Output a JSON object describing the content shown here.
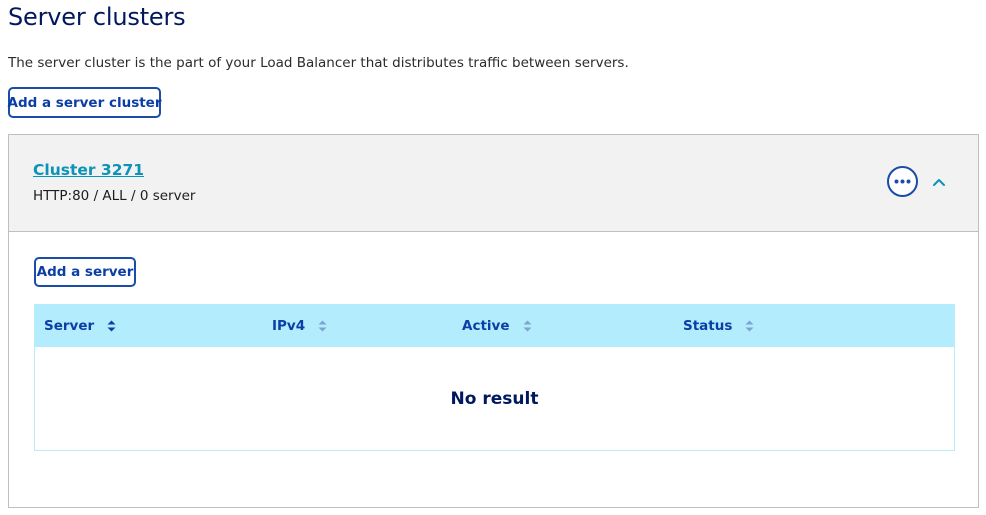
{
  "page": {
    "title": "Server clusters",
    "description": "The server cluster is the part of your Load Balancer that distributes traffic between servers.",
    "add_cluster_label": "Add a server cluster"
  },
  "cluster": {
    "name": "Cluster 3271",
    "subtitle": "HTTP:80 / ALL / 0 server",
    "more_icon": "ellipsis-icon",
    "collapse_icon": "chevron-up-icon",
    "add_server_label": "Add a server"
  },
  "table": {
    "columns": [
      {
        "label": "Server",
        "sort": "active"
      },
      {
        "label": "IPv4",
        "sort": "none"
      },
      {
        "label": "Active",
        "sort": "none"
      },
      {
        "label": "Status",
        "sort": "none"
      }
    ],
    "empty_text": "No result"
  },
  "colors": {
    "title": "#00185e",
    "primary": "#1a4ca8",
    "link": "#0b93b8",
    "header_bg": "#f2f2f2",
    "table_head_bg": "#b3ecfc",
    "sort_active": "#0b3ea6",
    "sort_inactive": "#7fa3cf"
  }
}
